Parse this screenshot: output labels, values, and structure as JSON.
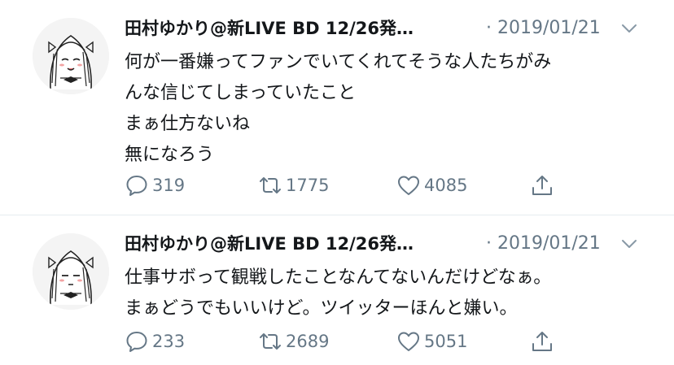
{
  "tweets": [
    {
      "author": "田村ゆかり@新LIVE BD 12/26発…",
      "date": "· 2019/01/21",
      "lines": [
        "何が一番嫌ってファンでいてくれてそうな人たちがみ",
        "んな信じてしまっていたこと",
        "まぁ仕方ないね",
        "無になろう"
      ],
      "replies": "319",
      "retweets": "1775",
      "likes": "4085"
    },
    {
      "author": "田村ゆかり@新LIVE BD 12/26発…",
      "date": "· 2019/01/21",
      "lines": [
        "仕事サボって観戦したことなんてないんだけどなぁ。",
        "まぁどうでもいいけど。ツイッターほんと嫌い。"
      ],
      "replies": "233",
      "retweets": "2689",
      "likes": "5051"
    }
  ],
  "icons": {
    "reply": "reply-bubble-icon",
    "retweet": "retweet-arrows-icon",
    "like": "heart-outline-icon",
    "share": "share-upload-icon",
    "caret": "chevron-down-icon"
  },
  "colors": {
    "text": "#14171a",
    "secondary": "#657786",
    "divider": "#e6ecf0"
  }
}
